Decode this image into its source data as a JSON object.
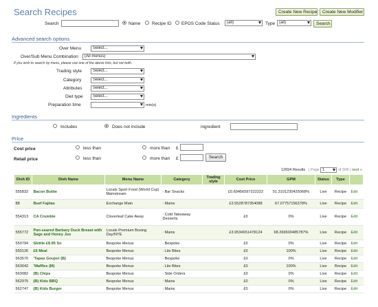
{
  "page": {
    "title": "Search Recipes",
    "create_recipe": "Create New Recipe",
    "create_modifier": "Create New Modifier"
  },
  "search": {
    "label": "Search",
    "value": "",
    "opt_name": "Name",
    "opt_recipe_id": "Recipe ID",
    "opt_epos": "EPOS Code Status",
    "epos_status": "(all)",
    "type_label": "Type",
    "type_value": "(all)",
    "button": "Search"
  },
  "advanced": {
    "heading": "Advanced search options",
    "over_menu_label": "Over Menu",
    "over_menu_value": "Select...",
    "combo_label": "Over/Sub Menu Combination",
    "combo_value": "(All menus)",
    "hint": "If you wish to search by menu, please use one of the above lists, but not both.",
    "trading_label": "Trading style",
    "trading_value": "Select...",
    "category_label": "Category",
    "category_value": "Select...",
    "attributes_label": "Attributes",
    "attributes_value": "Select...",
    "diet_label": "Diet type",
    "diet_value": "Select...",
    "prep_label": "Preparation time",
    "prep_value": "",
    "prep_unit": "min(s)"
  },
  "ingredients": {
    "heading": "Ingredients",
    "includes": "Includes",
    "not_include": "Does not include",
    "ingredient_label": "ingredient",
    "ingredient_value": ""
  },
  "price": {
    "heading": "Price",
    "cost_label": "Cost price",
    "retail_label": "Retail price",
    "less_than": "less than",
    "more_than": "more than",
    "currency": "£",
    "search_button": "Search"
  },
  "results": {
    "count_text": "12694 Results",
    "page_label": "Page",
    "page_value": "1",
    "of_text": "of 508",
    "next": "next »"
  },
  "table": {
    "headers": [
      "Dish ID",
      "Dish Name",
      "Menu Name",
      "Category",
      "Trading style",
      "Cost Price",
      "GPM",
      "Status",
      "Type",
      ""
    ],
    "rows": [
      {
        "id": "555832",
        "name": "Bacon Buttie",
        "menu": "Locals Sport Food (World Cup) Mainstream",
        "category": "Bar Snacks",
        "trading": "",
        "cost": "£0.60456597222222",
        "gpm": "51.3101230425068%",
        "status": "Live",
        "type": "Recipe",
        "edit": "Edit"
      },
      {
        "id": "88",
        "name": "Beef Fajitas",
        "menu": "Exchange Main",
        "category": "Mains",
        "trading": "",
        "cost": "£3.5528787354088",
        "gpm": "67.07757156378%",
        "status": "Live",
        "type": "Recipe",
        "edit": "Edit"
      },
      {
        "id": "554313",
        "name": "CA Crumble",
        "menu": "Cloverleaf Cake Away",
        "category": "Cold Takeaway Desserts",
        "trading": "",
        "cost": "£0",
        "gpm": "0%",
        "status": "Live",
        "type": "Recipe",
        "edit": "Edit"
      },
      {
        "id": "555772",
        "name": "Pan-seared Barbary Duck Breast with Sage and Honey Jus",
        "menu": "Locals Premium Boxing Day/NYE",
        "category": "Mains",
        "trading": "",
        "cost": "£3.9534651478124",
        "gpm": "68.266500485787%",
        "status": "Live",
        "type": "Recipe",
        "edit": "Edit"
      },
      {
        "id": "550794",
        "name": "Skittle £8.95 Sn",
        "menu": "Bespoke Menus",
        "category": "Bespoke",
        "trading": "",
        "cost": "£0",
        "gpm": "0%",
        "status": "Live",
        "type": "Recipe",
        "edit": "Edit"
      },
      {
        "id": "550126",
        "name": "£6 Meal",
        "menu": "Bespoke Menus",
        "category": "Lite Bites",
        "trading": "",
        "cost": "£0",
        "gpm": "100%",
        "status": "Live",
        "type": "Recipe",
        "edit": "Edit"
      },
      {
        "id": "563570",
        "name": "'Tapas Goujon (B)",
        "menu": "Bespoke Menus",
        "category": "Bespoke",
        "trading": "",
        "cost": "£0",
        "gpm": "0%",
        "status": "Live",
        "type": "Recipe",
        "edit": "Edit"
      },
      {
        "id": "563042",
        "name": "'Waffles (M)",
        "menu": "Bespoke Menus",
        "category": "Lite Bites",
        "trading": "",
        "cost": "£0",
        "gpm": "100%",
        "status": "Live",
        "type": "Recipe",
        "edit": "Edit"
      },
      {
        "id": "563082",
        "name": "(B) Chips",
        "menu": "Bespoke Menus",
        "category": "Side Orders",
        "trading": "",
        "cost": "£0",
        "gpm": "0%",
        "status": "Live",
        "type": "Recipe",
        "edit": "Edit"
      },
      {
        "id": "562975",
        "name": "(B) Kids BBQ",
        "menu": "Bespoke Menus",
        "category": "Mains",
        "trading": "",
        "cost": "£0",
        "gpm": "0%",
        "status": "Live",
        "type": "Recipe",
        "edit": "Edit"
      },
      {
        "id": "562747",
        "name": "(B) Kids Burger",
        "menu": "Bespoke Menus",
        "category": "Mains",
        "trading": "",
        "cost": "£0",
        "gpm": "0%",
        "status": "Live",
        "type": "Recipe",
        "edit": "Edit"
      }
    ]
  }
}
